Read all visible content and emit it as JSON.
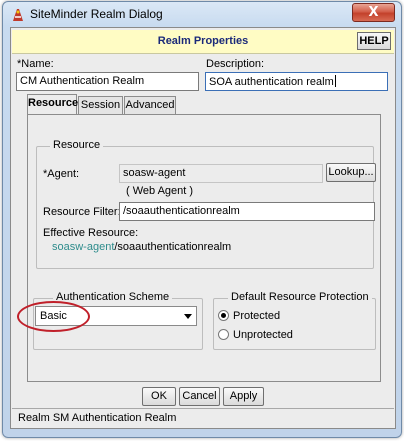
{
  "window": {
    "title": "SiteMinder Realm Dialog",
    "close_label": "X"
  },
  "header": {
    "title": "Realm Properties",
    "help_label": "HELP"
  },
  "fields": {
    "name_label": "*Name:",
    "name_value": "CM Authentication Realm",
    "description_label": "Description:",
    "description_value": "SOA authentication realm"
  },
  "tabs": [
    {
      "label": "Resource",
      "active": true
    },
    {
      "label": "Session",
      "active": false
    },
    {
      "label": "Advanced",
      "active": false
    }
  ],
  "resource": {
    "group_title": "Resource",
    "agent_label": "*Agent:",
    "agent_value": "soasw-agent",
    "lookup_label": "Lookup...",
    "agent_type": "( Web Agent )",
    "filter_label": "Resource Filter:",
    "filter_value": "/soaauthenticationrealm",
    "effective_label": "Effective Resource:",
    "effective_agent": "soasw-agent",
    "effective_path": "/soaauthenticationrealm"
  },
  "auth_scheme": {
    "group_title": "Authentication Scheme",
    "selected": "Basic"
  },
  "protection": {
    "group_title": "Default Resource Protection",
    "options": [
      {
        "label": "Protected",
        "checked": true
      },
      {
        "label": "Unprotected",
        "checked": false
      }
    ]
  },
  "buttons": {
    "ok": "OK",
    "cancel": "Cancel",
    "apply": "Apply"
  },
  "status": {
    "text": "Realm SM Authentication Realm"
  },
  "colors": {
    "header_bg": "#fffcc4",
    "header_text": "#1b2a7a",
    "link_teal": "#2e8c8c",
    "annotation_red": "#c0202a"
  }
}
